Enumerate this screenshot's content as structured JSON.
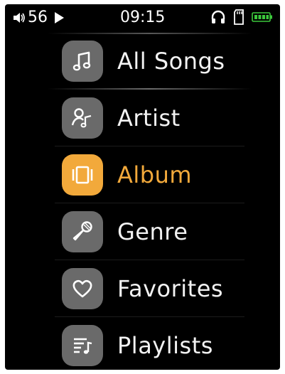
{
  "status": {
    "volume_level": "56",
    "time": "09:15",
    "icons": [
      "speaker-icon",
      "play-icon",
      "headphones-icon",
      "sd-card-icon",
      "battery-icon"
    ]
  },
  "menu": {
    "items": [
      {
        "label": "All Songs",
        "icon": "music-note-icon",
        "selected": false
      },
      {
        "label": "Artist",
        "icon": "artist-icon",
        "selected": false
      },
      {
        "label": "Album",
        "icon": "album-icon",
        "selected": true
      },
      {
        "label": "Genre",
        "icon": "microphone-icon",
        "selected": false
      },
      {
        "label": "Favorites",
        "icon": "heart-icon",
        "selected": false
      },
      {
        "label": "Playlists",
        "icon": "playlist-icon",
        "selected": false
      }
    ]
  },
  "colors": {
    "accent": "#f2a93b",
    "icon_tile": "#6a6a6a",
    "text": "#f2f2f2",
    "background": "#000000",
    "battery": "#3cc83c"
  }
}
